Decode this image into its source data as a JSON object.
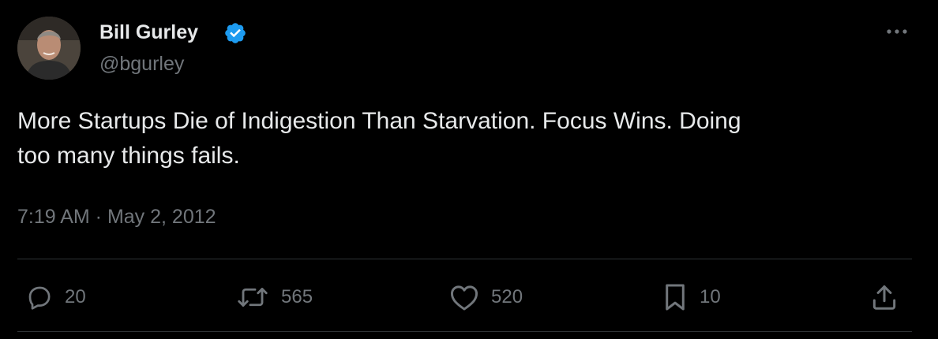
{
  "author": {
    "name": "Bill Gurley",
    "handle": "@bgurley",
    "verified": true
  },
  "tweet": {
    "text_line1": "More Startups Die of Indigestion Than Starvation.  Focus Wins.  Doing",
    "text_line2": "too many things fails.",
    "timestamp": "7:19 AM · May 2, 2012"
  },
  "actions": {
    "reply_count": "20",
    "retweet_count": "565",
    "like_count": "520",
    "bookmark_count": "10"
  },
  "colors": {
    "background": "#000000",
    "text": "#e7e9ea",
    "secondary": "#71767b",
    "verified": "#1d9bf0",
    "divider": "#2f3336"
  },
  "icons": [
    "more-icon",
    "verified-badge-icon",
    "reply-icon",
    "retweet-icon",
    "like-icon",
    "bookmark-icon",
    "share-icon"
  ]
}
